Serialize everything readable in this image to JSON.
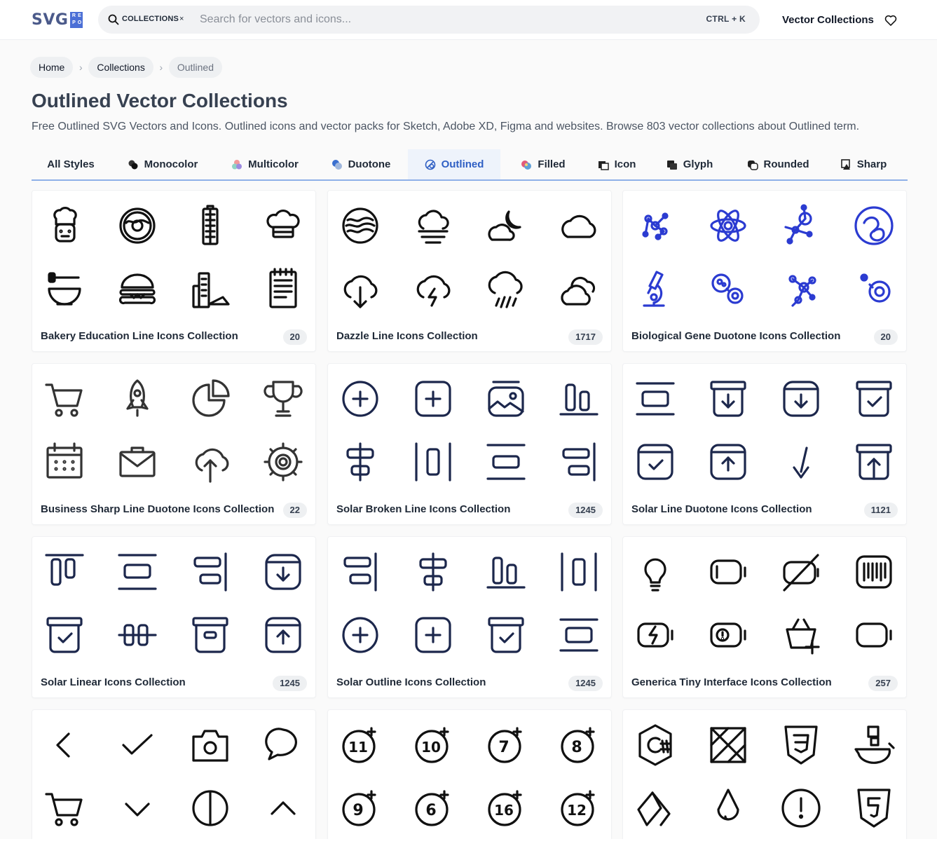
{
  "header": {
    "logo": {
      "text": "SVG",
      "badge": [
        "R",
        "E",
        "P",
        "O"
      ]
    },
    "search": {
      "chip": "COLLECTIONS",
      "chip_close": "×",
      "placeholder": "Search for vectors and icons...",
      "shortcut": "CTRL + K"
    },
    "nav_link": "Vector Collections"
  },
  "breadcrumb": [
    "Home",
    "Collections",
    "Outlined"
  ],
  "page": {
    "title": "Outlined Vector Collections",
    "description": "Free Outlined SVG Vectors and Icons. Outlined icons and vector packs for Sketch, Adobe XD, Figma and websites. Browse 803 vector collections about Outlined term."
  },
  "tabs": [
    {
      "label": "All Styles",
      "icon": "none",
      "active": false
    },
    {
      "label": "Monocolor",
      "icon": "monocolor-icon",
      "active": false
    },
    {
      "label": "Multicolor",
      "icon": "multicolor-icon",
      "active": false
    },
    {
      "label": "Duotone",
      "icon": "duotone-icon",
      "active": false
    },
    {
      "label": "Outlined",
      "icon": "outlined-icon",
      "active": true
    },
    {
      "label": "Filled",
      "icon": "filled-icon",
      "active": false
    },
    {
      "label": "Icon",
      "icon": "icon-style-icon",
      "active": false
    },
    {
      "label": "Glyph",
      "icon": "glyph-icon",
      "active": false
    },
    {
      "label": "Rounded",
      "icon": "rounded-icon",
      "active": false
    },
    {
      "label": "Sharp",
      "icon": "sharp-icon",
      "active": false
    }
  ],
  "collections": [
    {
      "title": "Bakery Education Line Icons Collection",
      "count": "20",
      "color": "#111111",
      "icons": [
        "chef-face-icon",
        "donut-icon",
        "tall-building-icon",
        "chef-hat-icon",
        "honey-bowl-icon",
        "burger-icon",
        "city-cake-icon",
        "notepad-icon"
      ]
    },
    {
      "title": "Dazzle Line Icons Collection",
      "count": "1717",
      "color": "#111111",
      "icons": [
        "wind-circle-icon",
        "fog-cloud-icon",
        "moon-cloud-icon",
        "cloud-icon",
        "cloud-download-icon",
        "cloud-lightning-icon",
        "cloud-rain-icon",
        "double-cloud-icon"
      ]
    },
    {
      "title": "Biological Gene Duotone Icons Collection",
      "count": "20",
      "color": "#2b3bd1",
      "icons": [
        "molecule-icon",
        "atom-icon",
        "network-node-icon",
        "dna-coil-icon",
        "microscope-icon",
        "cells-icon",
        "molecule-branch-icon",
        "cell-icon"
      ]
    },
    {
      "title": "Business Sharp Line Duotone Icons Collection",
      "count": "22",
      "color": "#333333",
      "icons": [
        "cart-icon",
        "rocket-icon",
        "pie-chart-icon",
        "trophy-icon",
        "calendar-icon",
        "briefcase-icon",
        "cloud-upload-icon",
        "gear-icon"
      ]
    },
    {
      "title": "Solar Broken Line Icons Collection",
      "count": "1245",
      "color": "#1c274c",
      "icons": [
        "add-circle-icon",
        "add-square-icon",
        "gallery-icon",
        "align-bottom-icon",
        "align-center-icon",
        "align-vertical-spacing-icon",
        "align-horizontal-icon",
        "align-right-icon"
      ]
    },
    {
      "title": "Solar Line Duotone Icons Collection",
      "count": "1121",
      "color": "#1c274c",
      "icons": [
        "align-horizontal-center-icon",
        "archive-down-icon",
        "archive-download-icon",
        "archive-check-icon",
        "check-square-icon",
        "archive-up-icon",
        "arrow-down-left-icon",
        "archive-up-box-icon"
      ]
    },
    {
      "title": "Solar Linear Icons Collection",
      "count": "1245",
      "color": "#1c274c",
      "icons": [
        "align-top-icon",
        "align-middle-icon",
        "align-right-bars-icon",
        "archive-minimalistic-icon",
        "archive-check-icon",
        "align-horizontal-spread-icon",
        "archive-icon",
        "archive-up-icon"
      ]
    },
    {
      "title": "Solar Outline Icons Collection",
      "count": "1245",
      "color": "#1c274c",
      "icons": [
        "align-right-bars-icon",
        "align-center-icon",
        "align-bottom-icon",
        "align-vertical-spacing-icon",
        "add-circle-icon",
        "add-square-icon",
        "archive-check-icon",
        "align-horizontal-center-icon"
      ]
    },
    {
      "title": "Generica Tiny Interface Icons Collection",
      "count": "257",
      "color": "#111111",
      "icons": [
        "bulb-icon",
        "battery-icon",
        "battery-off-icon",
        "barcode-icon",
        "battery-charging-icon",
        "battery-alert-icon",
        "basket-add-icon",
        "battery-empty-icon"
      ]
    },
    {
      "title": "",
      "count": "",
      "color": "#111111",
      "icons": [
        "chevron-left-icon",
        "check-icon",
        "camera-icon",
        "chat-bubble-icon",
        "cart-icon",
        "chevron-down-icon",
        "circle-line-icon",
        "chevron-up-icon"
      ]
    },
    {
      "title": "",
      "count": "",
      "color": "#111111",
      "icons": [
        "eleven-plus-icon",
        "ten-plus-icon",
        "seven-plus-icon",
        "eight-plus-icon",
        "nine-plus-icon",
        "six-plus-icon",
        "sixteen-plus-icon",
        "twelve-plus-icon"
      ]
    },
    {
      "title": "",
      "count": "",
      "color": "#111111",
      "icons": [
        "csharp-icon",
        "box-cross-icon",
        "css3-icon",
        "docker-icon",
        "tile-icon",
        "drop-icon",
        "alert-circle-icon",
        "html5-icon"
      ]
    }
  ]
}
